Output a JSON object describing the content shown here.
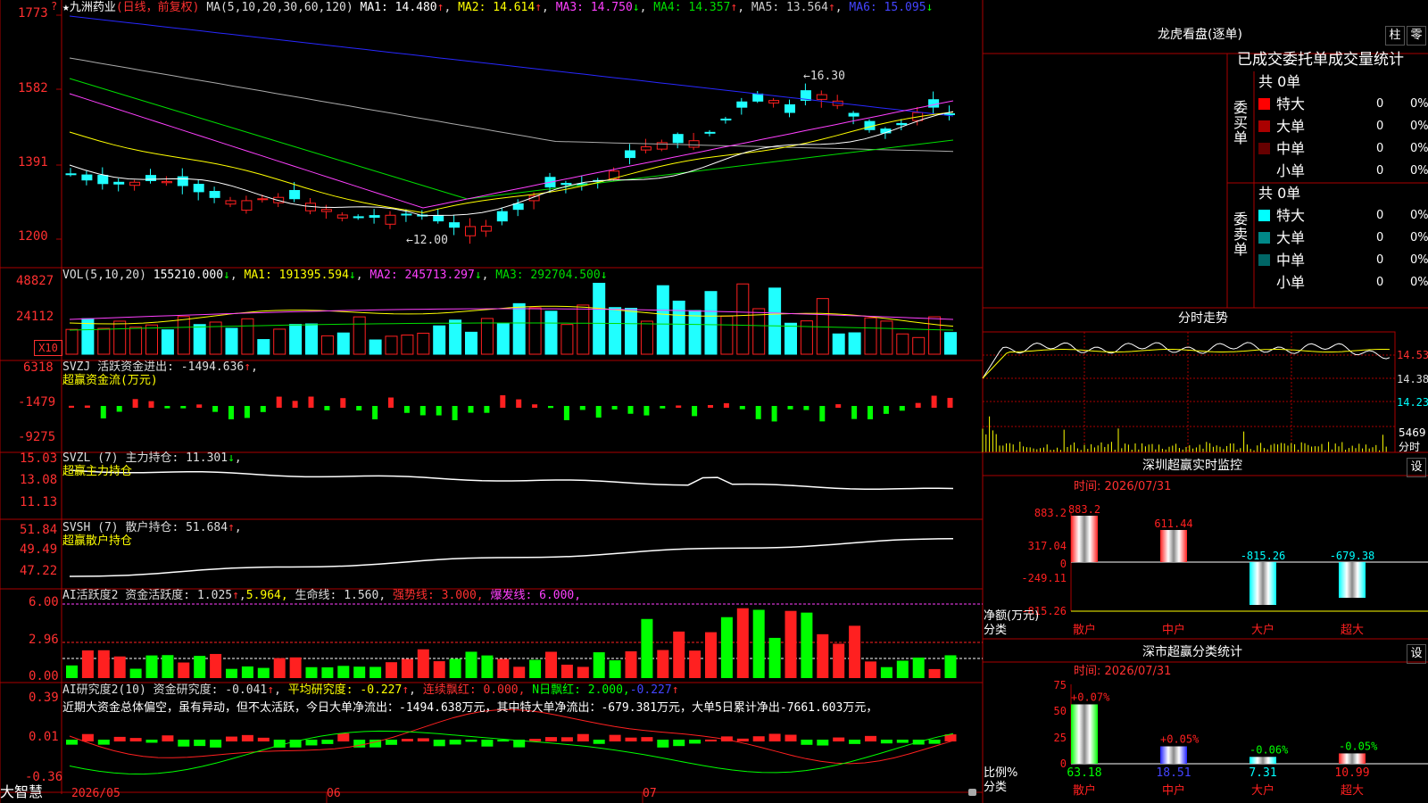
{
  "colors": {
    "up": "#ff2020",
    "down": "#20ffff",
    "ma1": "#ffffff",
    "ma2": "#ffff00",
    "ma3": "#ff40ff",
    "ma4": "#00dd00",
    "ma5": "#aaaaaa",
    "ma6": "#2828ff",
    "grid": "#aa0000"
  },
  "header": {
    "title": "九洲药业",
    "period": "(日线，前复权)",
    "ma_params": "MA(5,10,20,30,60,120)",
    "ma1": "MA1: 14.480",
    "ma2": "MA2: 14.614",
    "ma3": "MA3: 14.750",
    "ma4": "MA4: 14.357",
    "ma5": "MA5: 13.564",
    "ma6": "MA6: 15.095"
  },
  "price_axis": [
    "1773",
    "1582",
    "1391",
    "1200"
  ],
  "price_labels": {
    "high": "16.30",
    "low": "12.00"
  },
  "vol": {
    "label": "VOL(5,10,20)",
    "value": "155210.000",
    "ma1": "MA1: 191395.594",
    "ma2": "MA2: 245713.297",
    "ma3": "MA3: 292704.500",
    "axis": [
      "48827",
      "24112"
    ],
    "unit": "X10"
  },
  "svzj": {
    "label": "SVZJ  活跃资金进出: -1494.636",
    "sub": "超赢资金流(万元)",
    "axis": [
      "6318",
      "-1479",
      "-9275"
    ]
  },
  "svzl": {
    "label": "SVZL (7) 主力持仓: 11.301",
    "sub": "超赢主力持仓",
    "axis": [
      "15.03",
      "13.08",
      "11.13"
    ]
  },
  "svsh": {
    "label": "SVSH (7) 散户持仓: 51.684",
    "sub": "超赢散户持仓",
    "axis": [
      "51.84",
      "49.49",
      "47.22"
    ]
  },
  "ai1": {
    "label": "AI活跃度2 资金活跃度: 1.025",
    "v2": "5.964,",
    "life": "生命线: 1.560,",
    "strong": "强势线: 3.000,",
    "burst": "爆发线: 6.000,",
    "axis": [
      "6.00",
      "2.96",
      "0.00"
    ]
  },
  "ai2": {
    "label": "AI研究度2(10) 资金研究度: -0.041",
    "avg": "平均研究度: -0.227",
    "red": "连续飘红: 0.000,",
    "nred": "N日飘红: 2.000,",
    "last": "-0.227",
    "text": "近期大资金总体偏空，虽有异动，但不太活跃，今日大单净流出：-1494.638万元，其中特大单净流出：-679.381万元，大单5日累计净出-7661.603万元，",
    "axis": [
      "0.39",
      "0.01",
      "-0.36"
    ]
  },
  "dates": [
    "2026/05",
    "06",
    "07"
  ],
  "brand": "大智慧",
  "panel": {
    "title": "龙虎看盘(逐单)",
    "btn1": "柱",
    "btn2": "零",
    "subtitle": "已成交委托单成交量统计",
    "buy_label": "委买单",
    "sell_label": "委卖单",
    "buy_total": "共 0单",
    "sell_total": "共 0单",
    "buy_rows": [
      {
        "name": "特大",
        "n": "0",
        "p": "0%",
        "color": "#ff0000"
      },
      {
        "name": "大单",
        "n": "0",
        "p": "0%",
        "color": "#aa0000"
      },
      {
        "name": "中单",
        "n": "0",
        "p": "0%",
        "color": "#660000"
      },
      {
        "name": "小单",
        "n": "0",
        "p": "0%",
        "color": ""
      }
    ],
    "sell_rows": [
      {
        "name": "特大",
        "n": "0",
        "p": "0%",
        "color": "#00ffff"
      },
      {
        "name": "大单",
        "n": "0",
        "p": "0%",
        "color": "#008888"
      },
      {
        "name": "中单",
        "n": "0",
        "p": "0%",
        "color": "#006666"
      },
      {
        "name": "小单",
        "n": "0",
        "p": "0%",
        "color": ""
      }
    ]
  },
  "intraday": {
    "title": "分时走势",
    "axis": [
      "14.53",
      "14.38",
      "14.23"
    ],
    "vol": "5469",
    "vol_unit": "分时"
  },
  "monitor": {
    "title": "深圳超赢实时监控",
    "btn": "设",
    "time": "时间: 2026/07/31",
    "axis": [
      "883.2",
      "317.04",
      "0",
      "-249.11",
      "-815.26"
    ],
    "ylabel1": "净额(万元)",
    "ylabel2": "分类",
    "bars": [
      {
        "name": "散户",
        "value": 883.2,
        "label": "883.2"
      },
      {
        "name": "中户",
        "value": 611.44,
        "label": "611.44"
      },
      {
        "name": "大户",
        "value": -815.26,
        "label": "-815.26"
      },
      {
        "name": "超大",
        "value": -679.38,
        "label": "-679.38"
      }
    ]
  },
  "stats": {
    "title": "深市超赢分类统计",
    "btn": "设",
    "time": "时间: 2026/07/31",
    "axis": [
      "75",
      "50",
      "25",
      "0"
    ],
    "ylabel1": "比例%",
    "ylabel2": "分类",
    "bars": [
      {
        "name": "散户",
        "value": 63.18,
        "label": "63.18",
        "change": "+0.07%"
      },
      {
        "name": "中户",
        "value": 18.51,
        "label": "18.51",
        "change": "+0.05%"
      },
      {
        "name": "大户",
        "value": 7.31,
        "label": "7.31",
        "change": "-0.06%"
      },
      {
        "name": "超大",
        "value": 10.99,
        "label": "10.99",
        "change": "-0.05%"
      }
    ]
  }
}
